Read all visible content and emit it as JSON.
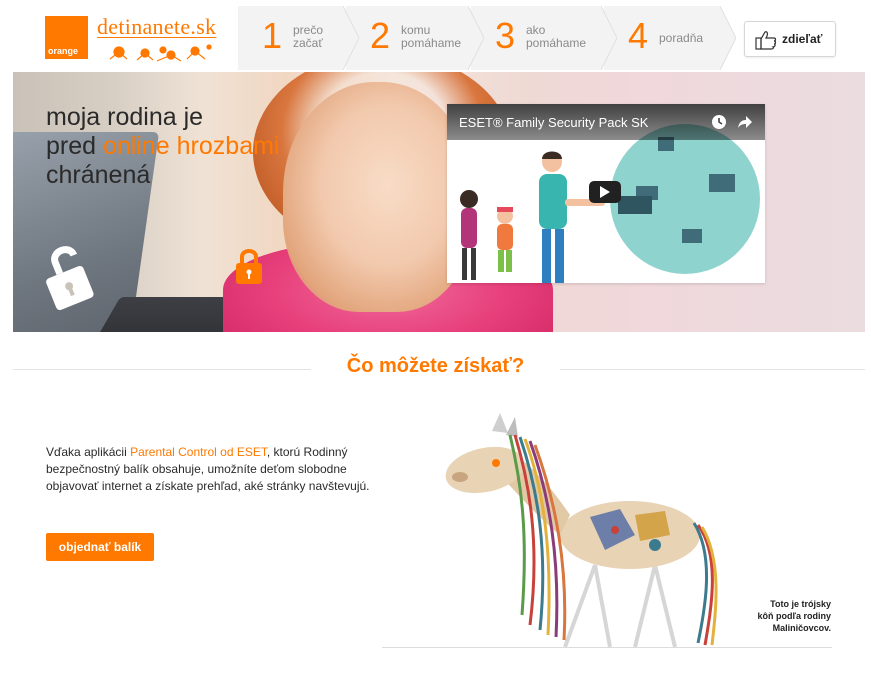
{
  "colors": {
    "brand_orange": "#ff7900",
    "step_bg": "#f3f3f3",
    "video_circle": "#8fd3cf"
  },
  "header": {
    "orange_logo_text": "orange",
    "site_name": "detinanete.sk",
    "steps": [
      {
        "number": "1",
        "line1": "prečo",
        "line2": "začať"
      },
      {
        "number": "2",
        "line1": "komu",
        "line2": "pomáhame"
      },
      {
        "number": "3",
        "line1": "ako",
        "line2": "pomáhame"
      },
      {
        "number": "4",
        "line1": "poradňa",
        "line2": ""
      }
    ],
    "share_label": "zdieľať",
    "share_icon": "thumbs-up-icon"
  },
  "hero": {
    "headline_line1": "moja rodina je",
    "headline_line2_prefix": "pred ",
    "headline_line2_highlight": "online hrozbami",
    "headline_line3": "chránená",
    "video": {
      "title": "ESET® Family Security Pack SK",
      "icons": [
        "clock-icon",
        "share-arrow-icon",
        "play-icon"
      ]
    }
  },
  "section": {
    "title": "Čo môžete získať?",
    "desc_prefix": "Vďaka aplikácii ",
    "desc_highlight": "Parental Control od ESET",
    "desc_suffix": ", ktorú Rodinný bezpečnostný balík obsahuje, umožníte deťom slobodne objavovať internet a získate prehľad, aké stránky navštevujú.",
    "order_button": "objednať balík",
    "caption_line1": "Toto je trójsky",
    "caption_line2": "kôň podľa rodiny",
    "caption_line3": "Maliničovcov."
  }
}
